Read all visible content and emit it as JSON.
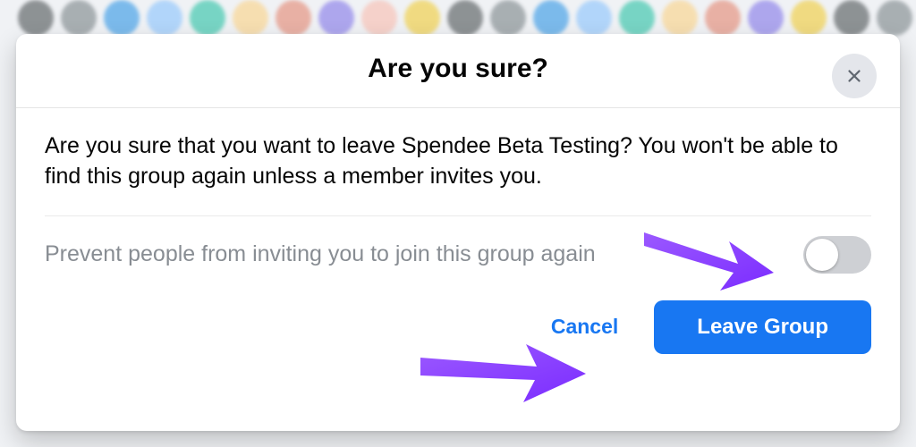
{
  "modal": {
    "title": "Are you sure?",
    "message": "Are you sure that you want to leave Spendee Beta Testing? You won't be able to find this group again unless a member invites you.",
    "toggle_label": "Prevent people from inviting you to join this group again",
    "cancel_label": "Cancel",
    "primary_label": "Leave Group"
  }
}
